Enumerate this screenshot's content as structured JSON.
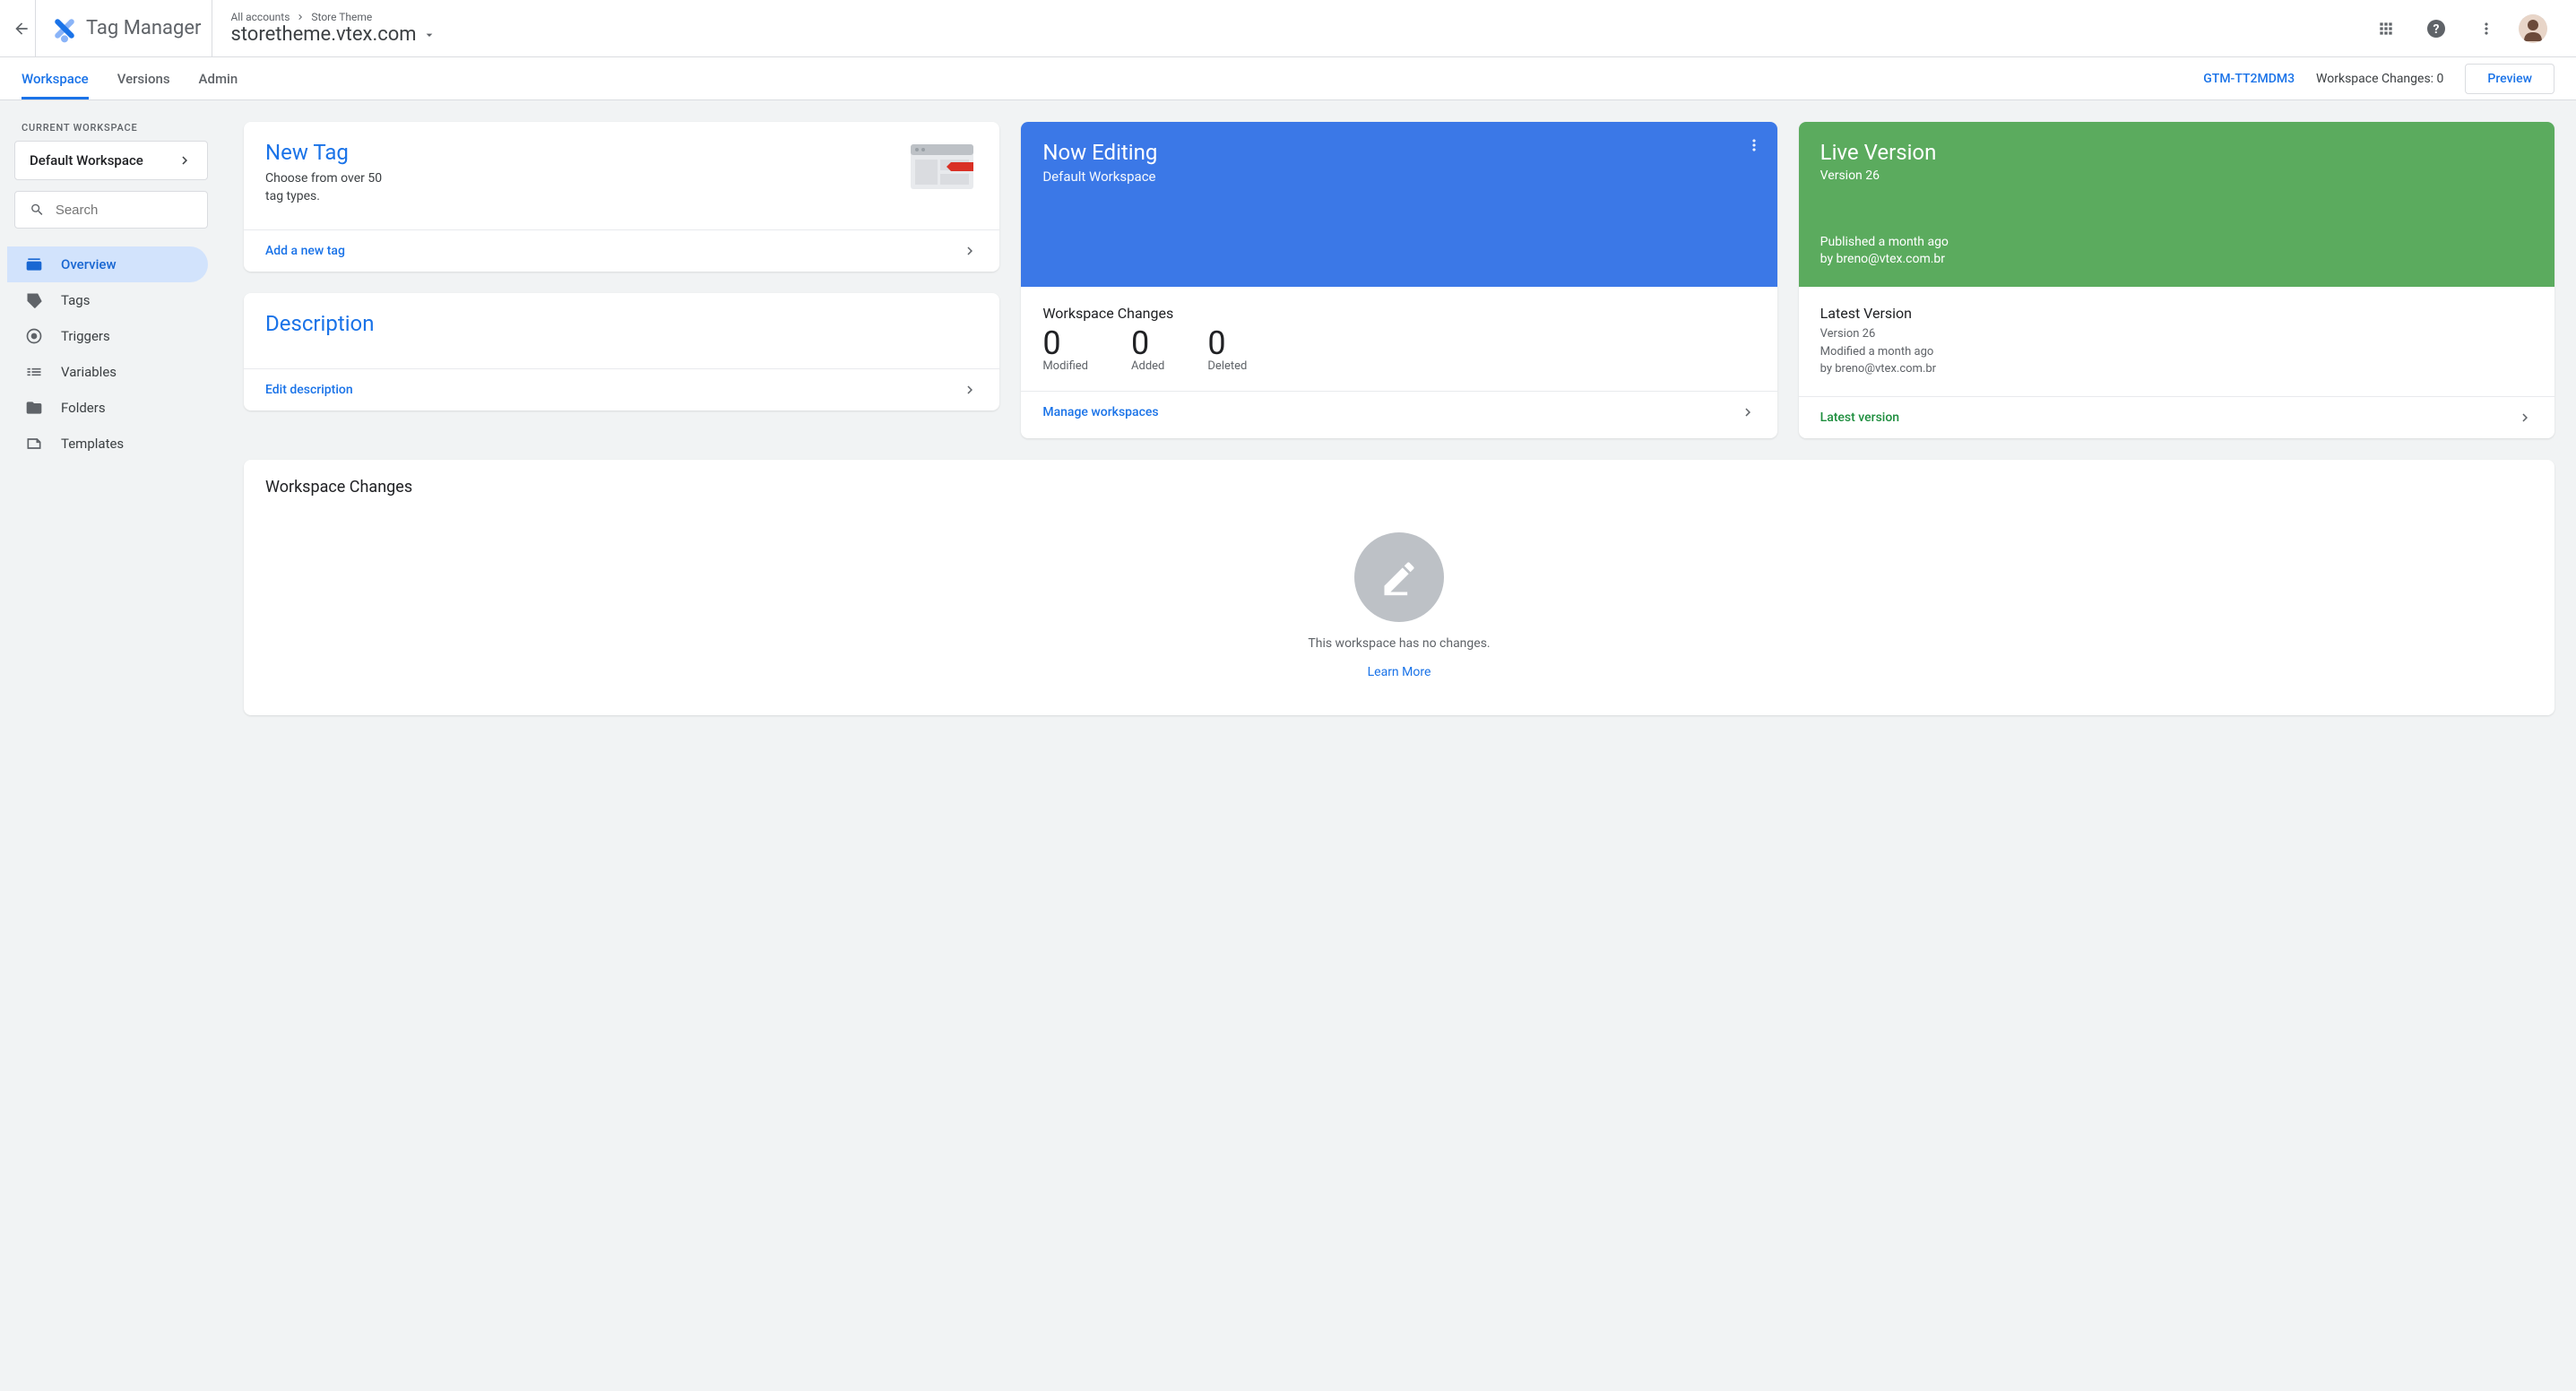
{
  "header": {
    "app_name": "Tag Manager",
    "breadcrumb_root": "All accounts",
    "breadcrumb_leaf": "Store Theme",
    "container_name": "storetheme.vtex.com"
  },
  "tabs": {
    "workspace": "Workspace",
    "versions": "Versions",
    "admin": "Admin"
  },
  "tabs_right": {
    "container_id": "GTM-TT2MDM3",
    "ws_changes_label": "Workspace Changes:",
    "ws_changes_count": "0",
    "preview": "Preview"
  },
  "sidebar": {
    "current_ws_label": "CURRENT WORKSPACE",
    "ws_name": "Default Workspace",
    "search_placeholder": "Search",
    "nav": {
      "overview": "Overview",
      "tags": "Tags",
      "triggers": "Triggers",
      "variables": "Variables",
      "folders": "Folders",
      "templates": "Templates"
    }
  },
  "cards": {
    "new_tag": {
      "title": "New Tag",
      "subtitle": "Choose from over 50 tag types.",
      "action": "Add a new tag"
    },
    "description": {
      "title": "Description",
      "action": "Edit description"
    },
    "now_editing": {
      "title": "Now Editing",
      "subtitle": "Default Workspace",
      "stats_title": "Workspace Changes",
      "modified_n": "0",
      "modified_l": "Modified",
      "added_n": "0",
      "added_l": "Added",
      "deleted_n": "0",
      "deleted_l": "Deleted",
      "action": "Manage workspaces"
    },
    "live": {
      "title": "Live Version",
      "subtitle": "Version 26",
      "pub_when": "Published a month ago",
      "pub_by": "by breno@vtex.com.br",
      "latest_title": "Latest Version",
      "latest_ver": "Version 26",
      "latest_mod": "Modified a month ago",
      "latest_by": "by breno@vtex.com.br",
      "action": "Latest version"
    }
  },
  "changes": {
    "title": "Workspace Changes",
    "empty": "This workspace has no changes.",
    "learn": "Learn More"
  }
}
